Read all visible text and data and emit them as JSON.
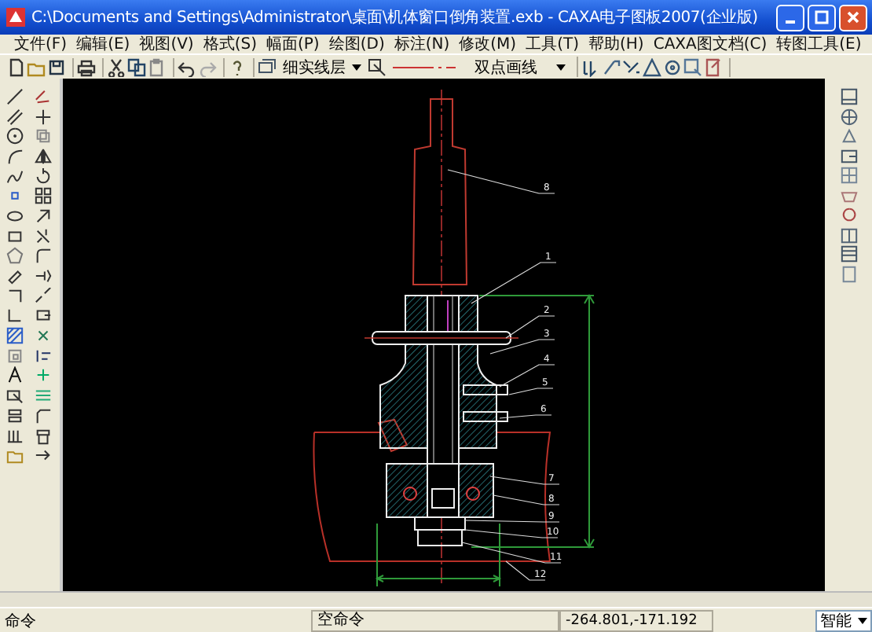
{
  "window": {
    "title": "C:\\Documents and Settings\\Administrator\\桌面\\机体窗口倒角装置.exb - CAXA电子图板2007(企业版)"
  },
  "menu": [
    "文件(F)",
    "编辑(E)",
    "视图(V)",
    "格式(S)",
    "幅面(P)",
    "绘图(D)",
    "标注(N)",
    "修改(M)",
    "工具(T)",
    "帮助(H)",
    "CAXA图文档(C)",
    "转图工具(E)"
  ],
  "toolbar": {
    "layer_select": "细实线层",
    "linetype_select": "双点画线"
  },
  "drawing": {
    "part_labels": [
      "8",
      "1",
      "2",
      "3",
      "4",
      "5",
      "6",
      "7",
      "8",
      "9",
      "10",
      "11",
      "12"
    ]
  },
  "status_bar": {
    "prompt": "命令",
    "command": "空命令",
    "coordinates": "-264.801,-171.192",
    "mode_select": "智能"
  }
}
